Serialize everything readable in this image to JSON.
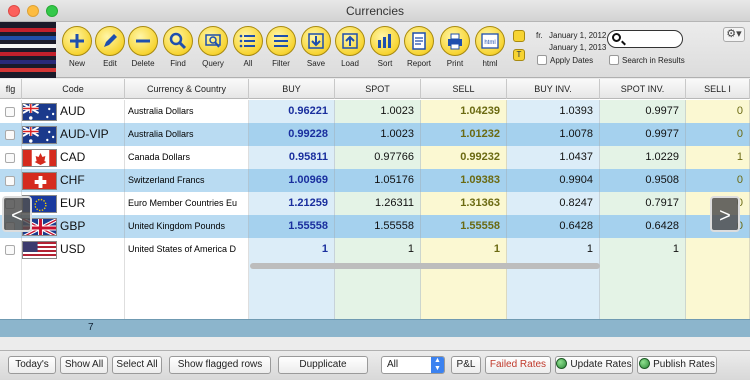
{
  "window": {
    "title": "Currencies"
  },
  "toolbar": {
    "buttons": [
      {
        "label": "New",
        "icon": "plus-icon"
      },
      {
        "label": "Edit",
        "icon": "pencil-icon"
      },
      {
        "label": "Delete",
        "icon": "minus-icon"
      },
      {
        "label": "Find",
        "icon": "magnifier-icon"
      },
      {
        "label": "Query",
        "icon": "query-icon"
      },
      {
        "label": "All",
        "icon": "list-icon"
      },
      {
        "label": "Filter",
        "icon": "filter-icon"
      },
      {
        "label": "Save",
        "icon": "save-icon"
      },
      {
        "label": "Load",
        "icon": "load-icon"
      },
      {
        "label": "Sort",
        "icon": "sort-icon"
      },
      {
        "label": "Report",
        "icon": "report-icon"
      },
      {
        "label": "Print",
        "icon": "printer-icon"
      },
      {
        "label": "html",
        "icon": "html-icon"
      }
    ],
    "date_from_prefix": "fr.",
    "date_from": "January 1, 2012",
    "date_to": "January 1, 2013",
    "apply_dates_label": "Apply Dates",
    "search_in_results_label": "Search in Results",
    "search_value": "",
    "t_label": "T"
  },
  "columns": [
    "flg",
    "Code",
    "Currency & Country",
    "BUY",
    "SPOT",
    "SELL",
    "BUY INV.",
    "SPOT INV.",
    "SELL I"
  ],
  "rows": [
    {
      "code": "AUD",
      "country": "Australia Dollars",
      "buy": "0.96221",
      "spot": "1.0023",
      "sell": "1.04239",
      "buy_inv": "1.0393",
      "spot_inv": "0.9977",
      "sell_inv": "0",
      "flag": "au"
    },
    {
      "code": "AUD-VIP",
      "country": "Australia Dollars",
      "buy": "0.99228",
      "spot": "1.0023",
      "sell": "1.01232",
      "buy_inv": "1.0078",
      "spot_inv": "0.9977",
      "sell_inv": "0",
      "flag": "au"
    },
    {
      "code": "CAD",
      "country": "Canada Dollars",
      "buy": "0.95811",
      "spot": "0.97766",
      "sell": "0.99232",
      "buy_inv": "1.0437",
      "spot_inv": "1.0229",
      "sell_inv": "1",
      "flag": "ca"
    },
    {
      "code": "CHF",
      "country": "Switzerland Francs",
      "buy": "1.00969",
      "spot": "1.05176",
      "sell": "1.09383",
      "buy_inv": "0.9904",
      "spot_inv": "0.9508",
      "sell_inv": "0",
      "flag": "ch"
    },
    {
      "code": "EUR",
      "country": "Euro Member Countries  Eu",
      "buy": "1.21259",
      "spot": "1.26311",
      "sell": "1.31363",
      "buy_inv": "0.8247",
      "spot_inv": "0.7917",
      "sell_inv": "0",
      "flag": "eu"
    },
    {
      "code": "GBP",
      "country": "United Kingdom Pounds",
      "buy": "1.55558",
      "spot": "1.55558",
      "sell": "1.55558",
      "buy_inv": "0.6428",
      "spot_inv": "0.6428",
      "sell_inv": "0",
      "flag": "gb"
    },
    {
      "code": "USD",
      "country": "United States of America D",
      "buy": "1",
      "spot": "1",
      "sell": "1",
      "buy_inv": "1",
      "spot_inv": "1",
      "sell_inv": "",
      "flag": "us"
    }
  ],
  "footer": {
    "count": "7"
  },
  "nav": {
    "prev": "<",
    "next": ">"
  },
  "bottom": {
    "todays": "Today's",
    "show_all": "Show All",
    "select_all": "Select All",
    "show_flagged": "Show flagged rows",
    "duplicate": "Dupplicate",
    "filter_value": "All",
    "pl": "P&L",
    "failed_rates": "Failed Rates",
    "update_rates": "Update Rates",
    "publish_rates": "Publish Rates"
  },
  "colors": {
    "buy_bg": "#dcedf8",
    "spot_bg": "#e4f3e6",
    "sell_bg": "#fbf8d2",
    "buy_text": "#1a2f9e",
    "sell_text": "#6b6a12",
    "selected_row": "#b9dbf2",
    "failed_rates_text": "#c0392b"
  }
}
